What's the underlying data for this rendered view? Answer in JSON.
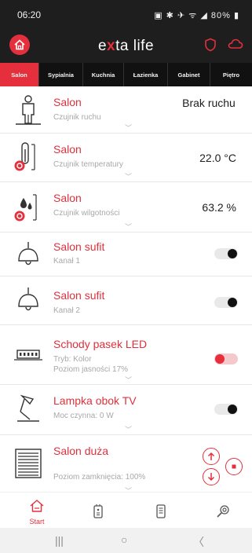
{
  "status_bar": {
    "time": "06:20",
    "battery": "80%"
  },
  "header": {
    "logo_prefix": "e",
    "logo_x": "x",
    "logo_suffix": "ta life"
  },
  "tabs": [
    {
      "label": "Salon",
      "active": true
    },
    {
      "label": "Sypialnia",
      "active": false
    },
    {
      "label": "Kuchnia",
      "active": false
    },
    {
      "label": "Łazienka",
      "active": false
    },
    {
      "label": "Gabinet",
      "active": false
    },
    {
      "label": "Piętro",
      "active": false
    }
  ],
  "devices": [
    {
      "name": "Salon",
      "subtitle": "Czujnik ruchu",
      "value": "Brak ruchu",
      "icon": "person-motion-icon"
    },
    {
      "name": "Salon",
      "subtitle": "Czujnik temperatury",
      "value": "22.0 °C",
      "icon": "thermometer-icon"
    },
    {
      "name": "Salon",
      "subtitle": "Czujnik wilgotności",
      "value": "63.2 %",
      "icon": "humidity-icon"
    },
    {
      "name": "Salon sufit",
      "subtitle": "Kanał 1",
      "toggle": "off",
      "icon": "ceiling-lamp-icon"
    },
    {
      "name": "Salon sufit",
      "subtitle": "Kanał 2",
      "toggle": "off",
      "icon": "ceiling-lamp-icon"
    },
    {
      "name": "Schody pasek LED",
      "subtitle": "Tryb: Kolor",
      "subtitle2": "Poziom jasności 17%",
      "toggle": "on",
      "icon": "led-strip-icon"
    },
    {
      "name": "Lampka obok TV",
      "subtitle": "Moc czynna: 0 W",
      "toggle": "off",
      "icon": "desk-lamp-icon"
    },
    {
      "name": "Salon duża",
      "subtitle": "Poziom zamknięcia: 100%",
      "icon": "roller-blind-icon"
    }
  ],
  "bottom_nav": {
    "start_label": "Start",
    "items": [
      "home-icon",
      "remote-icon",
      "tablet-icon",
      "settings-icon"
    ]
  },
  "colors": {
    "accent": "#e52f3c",
    "header_bg": "#1e1e1e",
    "tab_bg": "#111111"
  }
}
